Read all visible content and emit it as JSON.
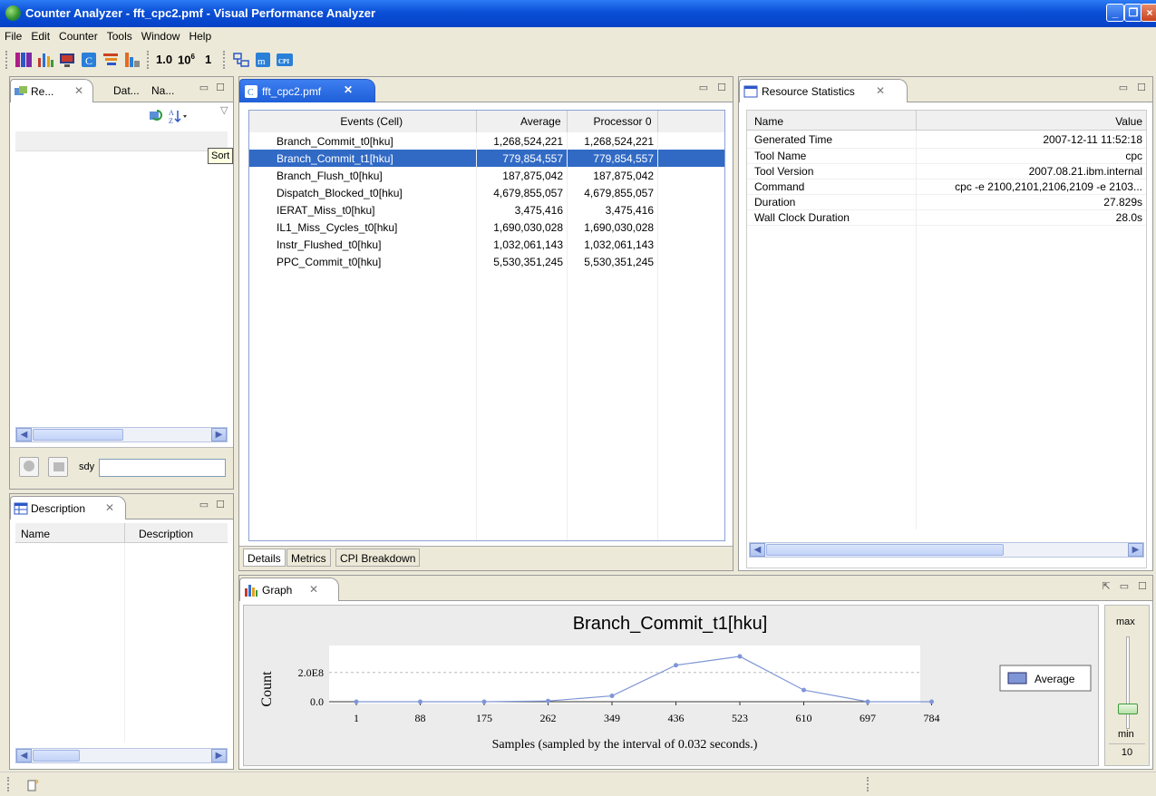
{
  "window": {
    "title": "Counter Analyzer - fft_cpc2.pmf - Visual Performance Analyzer"
  },
  "menu": [
    "File",
    "Edit",
    "Counter",
    "Tools",
    "Window",
    "Help"
  ],
  "toolbar": {
    "scale_1": "1.0",
    "scale_2": "10",
    "scale_2_sup": "6",
    "scale_3": "1",
    "cpi_label": "CPI"
  },
  "left_top": {
    "tab1": "Re...",
    "tab2": "Dat...",
    "tab3": "Na...",
    "tooltip": "Sort",
    "step_label": "sdy",
    "step_value": ""
  },
  "description": {
    "tab": "Description",
    "col_name": "Name",
    "col_desc": "Description"
  },
  "editor": {
    "tab": "fft_cpc2.pmf",
    "columns": [
      "Events (Cell)",
      "Average",
      "Processor 0"
    ],
    "rows": [
      {
        "event": "Branch_Commit_t0[hku]",
        "average": "1,268,524,221",
        "p0": "1,268,524,221"
      },
      {
        "event": "Branch_Commit_t1[hku]",
        "average": "779,854,557",
        "p0": "779,854,557"
      },
      {
        "event": "Branch_Flush_t0[hku]",
        "average": "187,875,042",
        "p0": "187,875,042"
      },
      {
        "event": "Dispatch_Blocked_t0[hku]",
        "average": "4,679,855,057",
        "p0": "4,679,855,057"
      },
      {
        "event": "IERAT_Miss_t0[hku]",
        "average": "3,475,416",
        "p0": "3,475,416"
      },
      {
        "event": "IL1_Miss_Cycles_t0[hku]",
        "average": "1,690,030,028",
        "p0": "1,690,030,028"
      },
      {
        "event": "Instr_Flushed_t0[hku]",
        "average": "1,032,061,143",
        "p0": "1,032,061,143"
      },
      {
        "event": "PPC_Commit_t0[hku]",
        "average": "5,530,351,245",
        "p0": "5,530,351,245"
      }
    ],
    "selected_row": 1,
    "bottom_tabs": [
      "Details",
      "Metrics",
      "CPI Breakdown"
    ]
  },
  "resource": {
    "tab": "Resource Statistics",
    "col_name": "Name",
    "col_value": "Value",
    "rows": [
      {
        "name": "Generated Time",
        "value": "2007-12-11 11:52:18"
      },
      {
        "name": "Tool Name",
        "value": "cpc"
      },
      {
        "name": "Tool Version",
        "value": "2007.08.21.ibm.internal"
      },
      {
        "name": "Command",
        "value": "cpc -e 2100,2101,2106,2109 -e 2103..."
      },
      {
        "name": "Duration",
        "value": "27.829s"
      },
      {
        "name": "Wall Clock Duration",
        "value": "28.0s"
      }
    ]
  },
  "graph": {
    "tab": "Graph",
    "slider_max": "max",
    "slider_min": "min",
    "slider_value": "10"
  },
  "colors": {
    "selection": "#316ac5",
    "series": "#7f96d6",
    "accent": "#0a4fd6"
  },
  "chart_data": {
    "type": "line",
    "title": "Branch_Commit_t1[hku]",
    "xlabel": "Samples (sampled by the interval of 0.032 seconds.)",
    "ylabel": "Count",
    "x_ticks": [
      "1",
      "88",
      "175",
      "262",
      "349",
      "436",
      "523",
      "610",
      "697",
      "784"
    ],
    "y_ticks": [
      "0.0",
      "2.0E8"
    ],
    "ylim": [
      0,
      360000000.0
    ],
    "legend": "right",
    "series": [
      {
        "name": "Average",
        "values": [
          0,
          0,
          0,
          5000000,
          40000000,
          250000000,
          310000000,
          80000000,
          0,
          0
        ]
      }
    ]
  }
}
